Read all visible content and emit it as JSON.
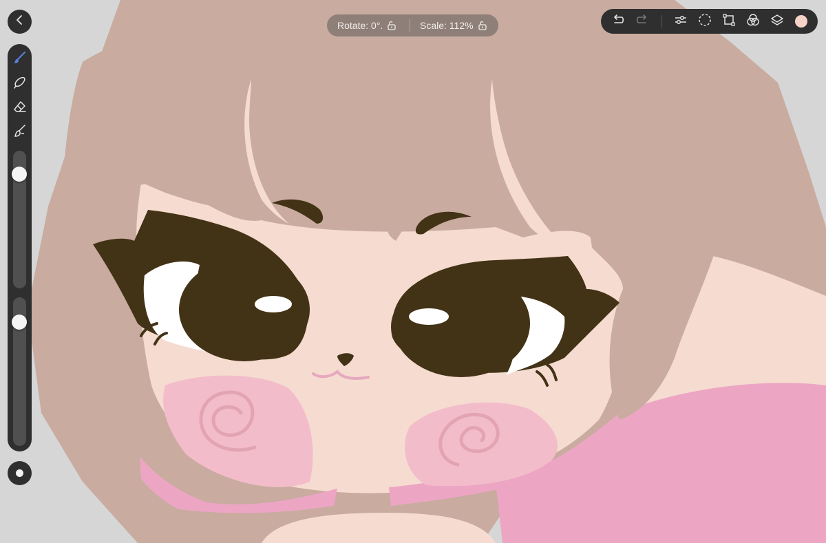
{
  "canvas": {
    "colors": {
      "background": "#d6d6d6",
      "hair": "#c9aba0",
      "skin": "#f6dbd0",
      "eye_dark": "#433316",
      "eye_white": "#ffffff",
      "blush": "#f3bcca",
      "blush_swirl": "#e2a4b2",
      "pink_clothes": "#eca6c4"
    }
  },
  "navigation": {
    "back_icon": "chevron-left-icon"
  },
  "transform_info": {
    "rotate_label": "Rotate: 0°.",
    "scale_label": "Scale: 112%",
    "rotate_lock_icon": "unlock-icon",
    "scale_lock_icon": "unlock-icon"
  },
  "left_tools": {
    "items": [
      {
        "name": "brush",
        "icon": "brush-icon",
        "active": true
      },
      {
        "name": "smudge",
        "icon": "smudge-icon",
        "active": false
      },
      {
        "name": "eraser",
        "icon": "eraser-icon",
        "active": false
      },
      {
        "name": "fill",
        "icon": "fill-brush-icon",
        "active": false
      }
    ],
    "active_color": "#5b7fe0",
    "icon_color": "#e6e6e6",
    "size_slider_value": 0.13,
    "opacity_slider_value": 0.87
  },
  "top_toolbar": {
    "items": [
      {
        "name": "undo",
        "icon": "undo-icon",
        "enabled": true
      },
      {
        "name": "redo",
        "icon": "redo-icon",
        "enabled": false
      },
      {
        "name": "adjustments",
        "icon": "sliders-icon"
      },
      {
        "name": "selection",
        "icon": "lasso-select-icon"
      },
      {
        "name": "transform",
        "icon": "transform-icon"
      },
      {
        "name": "color-mix",
        "icon": "blend-circles-icon"
      },
      {
        "name": "layers",
        "icon": "layers-icon"
      }
    ],
    "current_color": "#f6d3c6"
  }
}
